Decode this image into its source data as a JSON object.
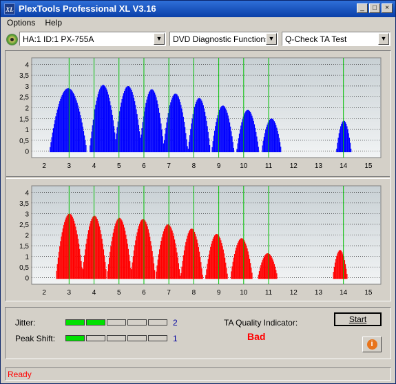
{
  "window": {
    "title": "PlexTools Professional XL V3.16",
    "icon_label": "XL"
  },
  "menu": {
    "items": [
      {
        "label": "Options"
      },
      {
        "label": "Help"
      }
    ]
  },
  "toolbar": {
    "drive": "HA:1 ID:1  PX-755A",
    "function": "DVD Diagnostic Functions",
    "test": "Q-Check TA Test"
  },
  "chart_data": [
    {
      "type": "area",
      "xlim": [
        1.5,
        15.5
      ],
      "ylim": [
        -0.3,
        4.3
      ],
      "x_ticks": [
        "2",
        "3",
        "4",
        "5",
        "6",
        "7",
        "8",
        "9",
        "10",
        "11",
        "12",
        "13",
        "14",
        "15"
      ],
      "y_ticks": [
        "0",
        "0,5",
        "1",
        "1,5",
        "2",
        "2,5",
        "3",
        "3,5",
        "4"
      ],
      "grid": true,
      "marker_lines_x": [
        3,
        4,
        5,
        6,
        7,
        8,
        9,
        10,
        11,
        14
      ],
      "series": [
        {
          "color": "#0000ff",
          "peaks": [
            {
              "center": 2.95,
              "height": 2.9,
              "width": 0.75
            },
            {
              "center": 4.35,
              "height": 3.05,
              "width": 0.55
            },
            {
              "center": 5.35,
              "height": 3.0,
              "width": 0.55
            },
            {
              "center": 6.3,
              "height": 2.85,
              "width": 0.5
            },
            {
              "center": 7.25,
              "height": 2.65,
              "width": 0.5
            },
            {
              "center": 8.2,
              "height": 2.45,
              "width": 0.45
            },
            {
              "center": 9.15,
              "height": 2.1,
              "width": 0.45
            },
            {
              "center": 10.15,
              "height": 1.9,
              "width": 0.45
            },
            {
              "center": 11.1,
              "height": 1.5,
              "width": 0.4
            },
            {
              "center": 14.0,
              "height": 1.4,
              "width": 0.3
            }
          ]
        }
      ]
    },
    {
      "type": "area",
      "xlim": [
        1.5,
        15.5
      ],
      "ylim": [
        -0.3,
        4.3
      ],
      "x_ticks": [
        "2",
        "3",
        "4",
        "5",
        "6",
        "7",
        "8",
        "9",
        "10",
        "11",
        "12",
        "13",
        "14",
        "15"
      ],
      "y_ticks": [
        "0",
        "0,5",
        "1",
        "1,5",
        "2",
        "2,5",
        "3",
        "3,5",
        "4"
      ],
      "grid": true,
      "marker_lines_x": [
        3,
        4,
        5,
        6,
        7,
        8,
        9,
        10,
        11,
        14
      ],
      "series": [
        {
          "color": "#ff0000",
          "peaks": [
            {
              "center": 3.0,
              "height": 3.0,
              "width": 0.55
            },
            {
              "center": 4.0,
              "height": 2.9,
              "width": 0.5
            },
            {
              "center": 5.0,
              "height": 2.8,
              "width": 0.5
            },
            {
              "center": 5.95,
              "height": 2.75,
              "width": 0.5
            },
            {
              "center": 6.95,
              "height": 2.5,
              "width": 0.5
            },
            {
              "center": 7.9,
              "height": 2.3,
              "width": 0.45
            },
            {
              "center": 8.9,
              "height": 2.05,
              "width": 0.45
            },
            {
              "center": 9.9,
              "height": 1.85,
              "width": 0.45
            },
            {
              "center": 10.95,
              "height": 1.15,
              "width": 0.4
            },
            {
              "center": 13.85,
              "height": 1.3,
              "width": 0.3
            }
          ]
        }
      ]
    }
  ],
  "metrics": {
    "jitter": {
      "label": "Jitter:",
      "value": "2",
      "level": 2,
      "max": 5
    },
    "peak_shift": {
      "label": "Peak Shift:",
      "value": "1",
      "level": 1,
      "max": 5
    },
    "ta_label": "TA Quality Indicator:",
    "ta_value": "Bad"
  },
  "buttons": {
    "start": "Start",
    "info_icon": "i"
  },
  "status": "Ready",
  "colors": {
    "title_bar": "#0a3fa8",
    "status_text": "#ff0000",
    "bad_text": "#ff0000",
    "marker_green": "#00c000"
  }
}
